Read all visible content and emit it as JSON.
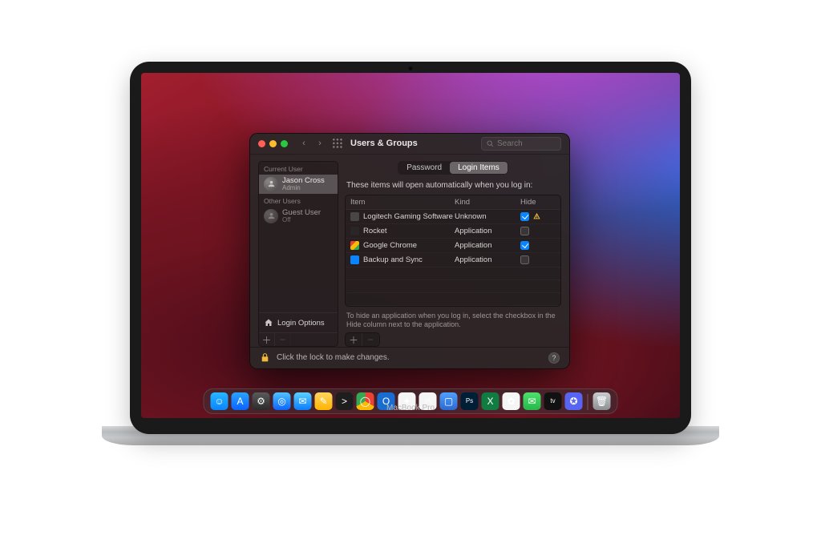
{
  "device_label": "MacBook Pro",
  "window": {
    "title": "Users & Groups",
    "search_placeholder": "Search"
  },
  "sidebar": {
    "current_header": "Current User",
    "other_header": "Other Users",
    "current_user": {
      "name": "Jason Cross",
      "role": "Admin"
    },
    "guest": {
      "name": "Guest User",
      "role": "Off"
    },
    "login_options": "Login Options"
  },
  "tabs": {
    "password": "Password",
    "login_items": "Login Items"
  },
  "main": {
    "heading": "These items will open automatically when you log in:",
    "col_item": "Item",
    "col_kind": "Kind",
    "col_hide": "Hide",
    "rows": [
      {
        "name": "Logitech Gaming Software",
        "kind": "Unknown",
        "hide": true,
        "warn": true,
        "color": "#4a4645"
      },
      {
        "name": "Rocket",
        "kind": "Application",
        "hide": false,
        "warn": false,
        "color": "#2a2627"
      },
      {
        "name": "Google Chrome",
        "kind": "Application",
        "hide": true,
        "warn": false,
        "color": "linear-gradient(135deg,#ea4335 0 33%,#fbbc05 33% 66%,#34a853 66%)"
      },
      {
        "name": "Backup and Sync",
        "kind": "Application",
        "hide": false,
        "warn": false,
        "color": "#0a84ff"
      }
    ],
    "hint": "To hide an application when you log in, select the checkbox in the Hide column next to the application."
  },
  "lock": {
    "text": "Click the lock to make changes."
  },
  "dock": {
    "items": [
      {
        "name": "finder",
        "bg": "linear-gradient(#27b7ff,#0a84ff)",
        "glyph": "☺"
      },
      {
        "name": "appstore",
        "bg": "linear-gradient(#2aa3ff,#0a63ff)",
        "glyph": "A"
      },
      {
        "name": "settings",
        "bg": "linear-gradient(#5a5a5a,#2a2a2a)",
        "glyph": "⚙"
      },
      {
        "name": "safari",
        "bg": "linear-gradient(#4fc3ff,#0a64ff)",
        "glyph": "◎"
      },
      {
        "name": "mail",
        "bg": "linear-gradient(#5ad1ff,#0a7cff)",
        "glyph": "✉"
      },
      {
        "name": "notes",
        "bg": "linear-gradient(#ffd560,#ffb400)",
        "glyph": "✎"
      },
      {
        "name": "terminal",
        "bg": "#1e1e1e",
        "glyph": ">"
      },
      {
        "name": "chrome",
        "bg": "conic-gradient(#ea4335 0 120deg,#fbbc05 120deg 240deg,#34a853 240deg)",
        "glyph": "◯"
      },
      {
        "name": "outlook",
        "bg": "#1a6dd0",
        "glyph": "O"
      },
      {
        "name": "slack",
        "bg": "#f5f5f5",
        "glyph": "✦"
      },
      {
        "name": "ia",
        "bg": "#f5f5f5",
        "glyph": "iA"
      },
      {
        "name": "preview",
        "bg": "linear-gradient(#4fa0ff,#2a6ad0)",
        "glyph": "▢"
      },
      {
        "name": "photoshop",
        "bg": "#001e36",
        "glyph": "Ps"
      },
      {
        "name": "excel",
        "bg": "#107c41",
        "glyph": "X"
      },
      {
        "name": "photos",
        "bg": "#f5f5f5",
        "glyph": "✿"
      },
      {
        "name": "messages",
        "bg": "linear-gradient(#4ce06b,#25b84a)",
        "glyph": "✉"
      },
      {
        "name": "appletv",
        "bg": "#111",
        "glyph": "tv"
      },
      {
        "name": "discord",
        "bg": "#5865f2",
        "glyph": "✪"
      }
    ]
  }
}
